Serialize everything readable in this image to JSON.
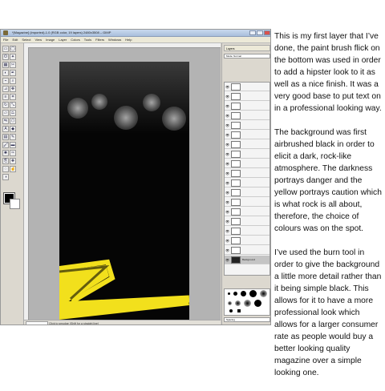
{
  "window": {
    "title": "*[Magazine] (imported)-1.0 (RGB color, 19 layers) 2480x3508 – GIMP",
    "menu": [
      "File",
      "Edit",
      "Select",
      "View",
      "Image",
      "Layer",
      "Colors",
      "Tools",
      "Filters",
      "Windows",
      "Help"
    ]
  },
  "status": {
    "zoom_value": "",
    "hint": "Click to smudge (Shift for a straight line)"
  },
  "layers_panel": {
    "header": "Layers",
    "mode_label": "Mode: Normal",
    "layers": [
      "",
      "",
      "",
      "",
      "",
      "",
      "",
      "",
      "",
      "",
      "",
      "",
      "",
      "",
      "",
      "",
      "",
      "",
      "Background"
    ]
  },
  "brushes": {
    "spacing_label": "Spacing"
  },
  "description": {
    "paragraphs": [
      "This is my first layer that I’ve done, the paint brush flick on the bottom was used in order to add a hipster look to it as well as a nice finish. It was a very good base to put text on in a professional looking way.",
      "The background was first airbrushed black in order to elicit a dark, rock-like atmosphere. The darkness portrays danger and the yellow portrays caution which is what rock is all about, therefore, the choice of colours was on the spot.",
      "I’ve used the burn tool in order to give the background a little more detail rather than it being simple black. This allows for it to have a more professional look which allows for a larger consumer rate as people would buy a better looking quality magazine over a simple looking one."
    ]
  },
  "colors": {
    "foreground": "#000000",
    "background": "#ffffff",
    "brush_stroke": "#f2e01c"
  }
}
